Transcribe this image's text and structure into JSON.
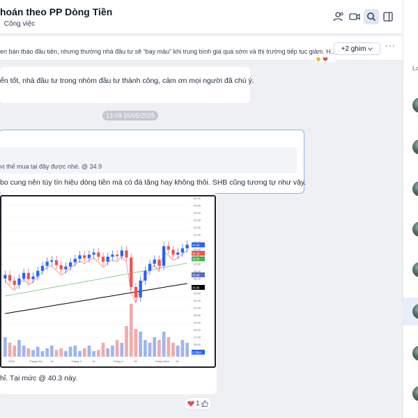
{
  "header": {
    "title": "hoán theo PP Dòng Tiền",
    "subtitle": "Công việc"
  },
  "pinned": {
    "text": "en bán tháo đầu tiên, nhưng thường nhà đầu tư sẽ “bay màu” khi trung bình giá quá sớm và thị trường tiếp tục giảm. H...",
    "button_label": "+2 ghim",
    "more_label": "···"
  },
  "side_panel": {
    "label": "Lo"
  },
  "messages": {
    "m1_text": "ển tốt, nhà đầu tư trong nhóm đầu tư thành công, cảm ơn mọi người đã chú ý.",
    "time": "13:09 15/05/2025",
    "quote_text": "vị thế mua tại đây được nhé. @ 34.9",
    "m2_text": "bo cung nên tùy tín hiệu dòng tiền mà có đà tăng hay không thôi. SHB cũng tương tự như vậy.",
    "m3_text": "hỉ. Tại mức @ 40.3 này.",
    "reaction_count": "1"
  },
  "chart_data": {
    "type": "candlestick",
    "title": "",
    "price_axis": [
      "40.00",
      "45.00",
      "44.00",
      "43.00",
      "42.00",
      "41.00",
      "40.00",
      "39.00",
      "38.00",
      "37.00",
      "36.00",
      "35.00",
      "34.00",
      "33.00",
      "32.00",
      "31.00",
      "30.00",
      "29.00",
      "28.00",
      "27.00",
      "26.00"
    ],
    "x_labels": [
      "2025",
      "Tháng Hai",
      "14",
      "Tháng 3",
      "14",
      "Tháng 4",
      "15",
      "Tháng Năm",
      "16"
    ],
    "price_tags": [
      "40.30",
      "39.15",
      "38.80",
      "36.45",
      "34.86",
      "0.3094"
    ],
    "close": [
      36.0,
      35.2,
      34.6,
      35.5,
      36.3,
      35.4,
      35.8,
      36.6,
      37.3,
      37.9,
      38.1,
      37.4,
      36.8,
      37.2,
      37.8,
      38.3,
      38.8,
      38.4,
      38.9,
      39.2,
      38.6,
      37.9,
      38.6,
      38.9,
      38.7,
      39.5,
      38.5,
      34.3,
      32.8,
      35.2,
      36.6,
      37.6,
      38.2,
      37.3,
      40.1,
      39.6,
      38.9,
      39.2,
      39.8,
      40.3
    ],
    "volume": [
      0.35,
      0.25,
      0.2,
      0.3,
      0.2,
      0.15,
      0.12,
      0.18,
      0.1,
      0.15,
      0.2,
      0.12,
      0.15,
      0.1,
      0.18,
      0.2,
      0.1,
      0.15,
      0.2,
      0.1,
      0.12,
      0.25,
      0.15,
      0.2,
      0.3,
      0.25,
      0.55,
      0.95,
      0.5,
      0.45,
      0.3,
      0.25,
      0.35,
      0.3,
      0.45,
      0.35,
      0.25,
      0.2,
      0.3,
      0.25
    ],
    "colors": {
      "up": "#2962ff",
      "down": "#ef5350",
      "ma_long": "#000000",
      "ma_mid": "#4caf50",
      "ma_short": "#ef5350"
    }
  },
  "colors": {
    "accent": "#2f6fed",
    "heart": "#e5484d"
  }
}
